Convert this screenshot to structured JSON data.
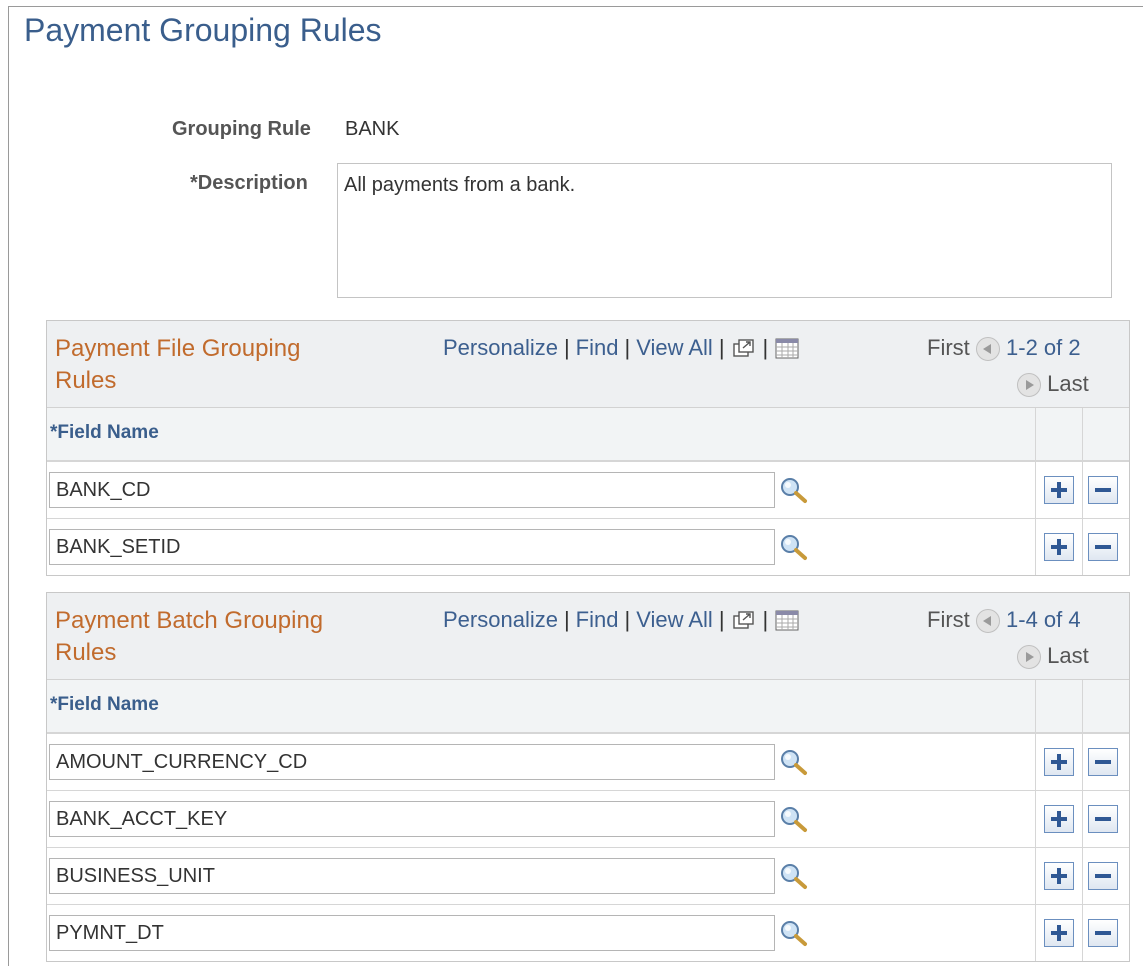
{
  "page": {
    "title": "Payment Grouping Rules"
  },
  "form": {
    "grouping_rule_label": "Grouping Rule",
    "grouping_rule_value": "BANK",
    "description_label": "*Description",
    "description_value": "All payments from a bank."
  },
  "grids": {
    "file": {
      "title": "Payment File Grouping Rules",
      "nav": {
        "personalize": "Personalize",
        "find": "Find",
        "view_all": "View All",
        "sep": "|"
      },
      "pager": {
        "first": "First",
        "range": "1-2 of 2",
        "last": "Last"
      },
      "column_header": "*Field Name",
      "rows": [
        "BANK_CD",
        "BANK_SETID"
      ]
    },
    "batch": {
      "title": "Payment Batch Grouping Rules",
      "nav": {
        "personalize": "Personalize",
        "find": "Find",
        "view_all": "View All",
        "sep": "|"
      },
      "pager": {
        "first": "First",
        "range": "1-4 of 4",
        "last": "Last"
      },
      "column_header": "*Field Name",
      "rows": [
        "AMOUNT_CURRENCY_CD",
        "BANK_ACCT_KEY",
        "BUSINESS_UNIT",
        "PYMNT_DT"
      ]
    }
  },
  "icons": {
    "zoom": "new-window-icon",
    "download": "download-grid-icon",
    "lookup": "magnifier-lookup-icon",
    "add": "add-row-icon",
    "delete": "delete-row-icon",
    "prev": "previous-circle-icon",
    "next": "next-circle-icon"
  },
  "colors": {
    "page_title": "#3a5e8c",
    "grid_title": "#c16b2d",
    "link": "#3c5f8f"
  }
}
